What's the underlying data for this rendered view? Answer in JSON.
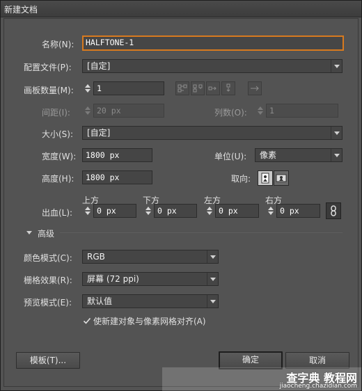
{
  "window": {
    "title": "新建文档"
  },
  "name": {
    "label": "名称(N):",
    "value": "HALFTONE-1"
  },
  "profile": {
    "label": "配置文件(P):",
    "value": "[自定]"
  },
  "artboards": {
    "count_label": "画板数量(M):",
    "count_value": "1",
    "spacing_label": "间距(I):",
    "spacing_value": "20 px",
    "columns_label": "列数(O):",
    "columns_value": "1"
  },
  "size": {
    "label": "大小(S):",
    "value": "[自定]"
  },
  "width": {
    "label": "宽度(W):",
    "value": "1800 px"
  },
  "units": {
    "label": "单位(U):",
    "value": "像素"
  },
  "height": {
    "label": "高度(H):",
    "value": "1800 px"
  },
  "orientation": {
    "label": "取向:"
  },
  "bleed": {
    "label": "出血(L):",
    "top_label": "上方",
    "top_value": "0 px",
    "bottom_label": "下方",
    "bottom_value": "0 px",
    "left_label": "左方",
    "left_value": "0 px",
    "right_label": "右方",
    "right_value": "0 px"
  },
  "advanced": {
    "label": "高级",
    "color_mode_label": "颜色模式(C):",
    "color_mode_value": "RGB",
    "raster_label": "栅格效果(R):",
    "raster_value": "屏幕 (72 ppi)",
    "preview_label": "预览模式(E):",
    "preview_value": "默认值",
    "align_label": "使新建对象与像素网格对齐(A)",
    "align_checked": true
  },
  "buttons": {
    "templates": "模板(T)...",
    "ok": "确定",
    "cancel": "取消"
  },
  "watermark": {
    "brand": "查字典 教程网",
    "url": "jiaocheng.chazidian.com"
  }
}
